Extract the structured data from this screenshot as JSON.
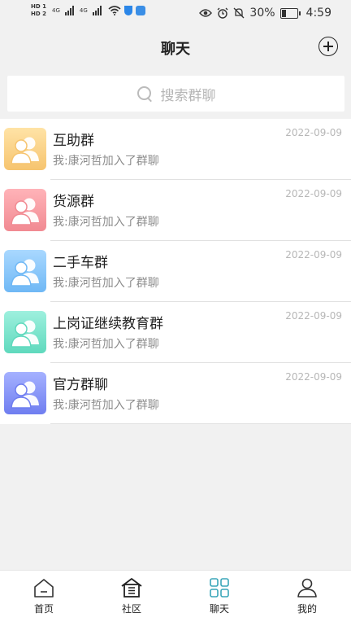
{
  "status_bar": {
    "hd1": "HD 1",
    "hd2": "HD 2",
    "net": "4G",
    "battery": "30%",
    "battery_level": 0.3,
    "time": "4:59"
  },
  "header": {
    "title": "聊天"
  },
  "search": {
    "placeholder": "搜索群聊"
  },
  "groups": [
    {
      "name": "互助群",
      "message": "我:康河哲加入了群聊",
      "date": "2022-09-09",
      "color_top": "#ffe3a6",
      "color_bottom": "#f6c46f"
    },
    {
      "name": "货源群",
      "message": "我:康河哲加入了群聊",
      "date": "2022-09-09",
      "color_top": "#ffb3b8",
      "color_bottom": "#f18a92"
    },
    {
      "name": "二手车群",
      "message": "我:康河哲加入了群聊",
      "date": "2022-09-09",
      "color_top": "#a9d8ff",
      "color_bottom": "#6fb8f5"
    },
    {
      "name": "上岗证继续教育群",
      "message": "我:康河哲加入了群聊",
      "date": "2022-09-09",
      "color_top": "#9ef0de",
      "color_bottom": "#5fd9bd"
    },
    {
      "name": "官方群聊",
      "message": "我:康河哲加入了群聊",
      "date": "2022-09-09",
      "color_top": "#a5b1ff",
      "color_bottom": "#6f7ef0"
    }
  ],
  "bottom_nav": {
    "items": [
      {
        "label": "首页",
        "icon": "home-icon"
      },
      {
        "label": "社区",
        "icon": "community-icon"
      },
      {
        "label": "聊天",
        "icon": "chat-grid-icon",
        "active": true
      },
      {
        "label": "我的",
        "icon": "profile-icon"
      }
    ]
  },
  "colors": {
    "accent": "#3aa6b9",
    "background": "#f1f1f1"
  }
}
